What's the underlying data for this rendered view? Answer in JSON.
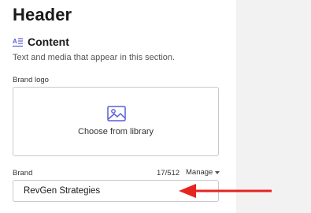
{
  "header": {
    "title": "Header"
  },
  "section": {
    "title": "Content",
    "icon": "text-format-icon",
    "description": "Text and media that appear in this section."
  },
  "brand_logo": {
    "label": "Brand logo",
    "action_label": "Choose from library",
    "icon": "image-icon"
  },
  "brand": {
    "label": "Brand",
    "char_count": "17/512",
    "manage_label": "Manage",
    "value": "RevGen Strategies"
  },
  "annotation": {
    "arrow_color": "#e52421"
  },
  "colors": {
    "accent": "#5a5fd6",
    "panel_background": "#ffffff",
    "canvas_background": "#f2f2f3"
  }
}
